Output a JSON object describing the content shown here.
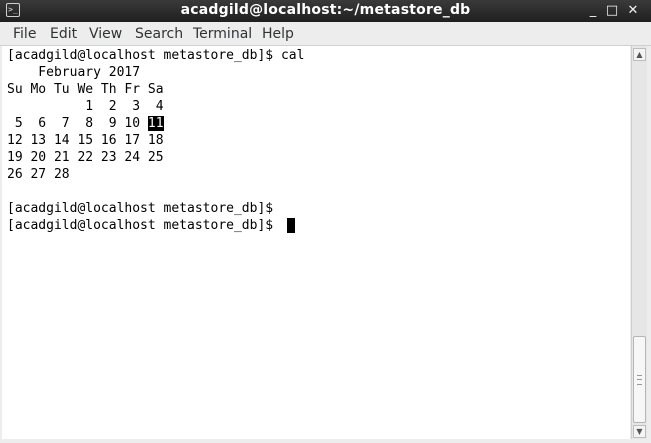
{
  "window": {
    "title": "acadgild@localhost:~/metastore_db",
    "icon": "terminal-icon",
    "controls": {
      "minimize": "_",
      "maximize": "□",
      "close": "✕"
    }
  },
  "menu": {
    "file": "File",
    "edit": "Edit",
    "view": "View",
    "search": "Search",
    "terminal": "Terminal",
    "help": "Help"
  },
  "terminal": {
    "prompt": "[acadgild@localhost metastore_db]$",
    "command": "cal",
    "cal_header": "    February 2017",
    "weekdays": "Su Mo Tu We Th Fr Sa",
    "week1": "          1  2  3  4",
    "week2_before": " 5  6  7  8  9 10 ",
    "week2_today": "11",
    "week3": "12 13 14 15 16 17 18",
    "week4": "19 20 21 22 23 24 25",
    "week5": "26 27 28"
  },
  "scrollbar": {
    "up_arrow": "▲",
    "down_arrow": "▼"
  }
}
